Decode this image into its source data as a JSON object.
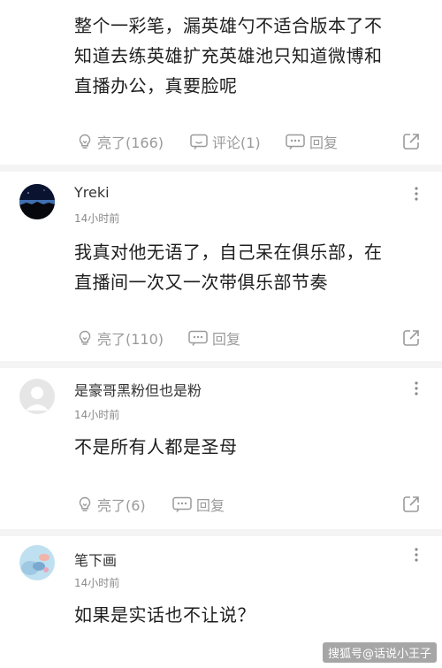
{
  "top_comment": {
    "text_lines": [
      "整个一彩笔，漏英雄勺不适合版本了不",
      "知道去练英雄扩充英雄池只知道微博和",
      "直播办公，真要脸呢"
    ],
    "like_label": "亮了(166)",
    "comment_label": "评论(1)",
    "reply_label": "回复"
  },
  "comments": [
    {
      "username": "Yreki",
      "time": "14小时前",
      "text_lines": [
        "我真对他无语了，自己呆在俱乐部，在",
        "直播间一次又一次带俱乐部节奏"
      ],
      "like_label": "亮了(110)",
      "reply_label": "回复"
    },
    {
      "username": "是豪哥黑粉但也是粉",
      "time": "14小时前",
      "text_lines": [
        "不是所有人都是圣母"
      ],
      "like_label": "亮了(6)",
      "reply_label": "回复"
    },
    {
      "username": "笔下画",
      "time": "14小时前",
      "text_lines": [
        "如果是实话也不让说？"
      ]
    }
  ],
  "watermark": "搜狐号@话说小王子",
  "icons": {
    "like": "lightbulb-icon",
    "comment": "comment-bubble-icon",
    "reply": "reply-bubble-icon",
    "share": "share-icon",
    "more": "more-vertical-icon"
  }
}
